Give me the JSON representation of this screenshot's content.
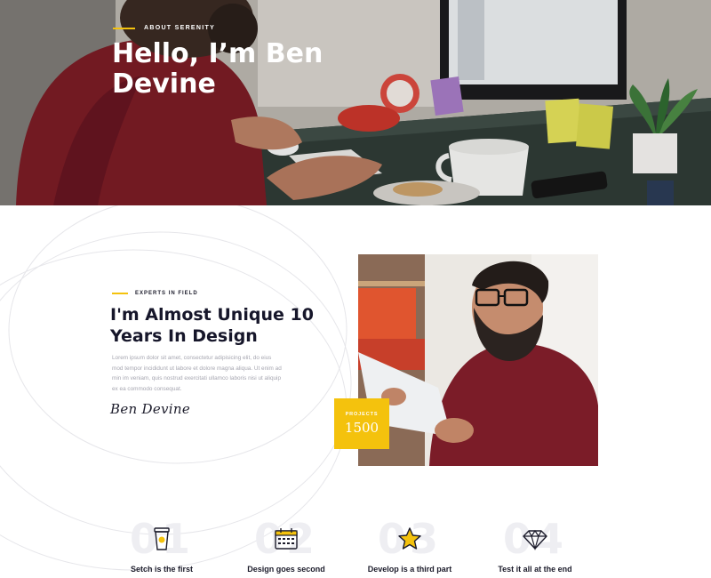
{
  "hero": {
    "tag": "ABOUT SERENITY",
    "title": "Hello, I’m Ben Devine"
  },
  "about": {
    "tag": "EXPERTS IN FIELD",
    "title": "I'm Almost Unique 10 Years In Design",
    "text": "Lorem ipsum dolor sit amet, consectetur adipisicing elit, do eius mod tempor incididunt ut labore et dolore magna aliqua. Ut enim ad min im veniam, quis nostrud exercitati ullamco laboris nisi ut aliquip ex ea commodo consequat.",
    "signature": "Ben Devine"
  },
  "projects": {
    "label": "PROJECTS",
    "count": "1500"
  },
  "steps": [
    {
      "number": "01",
      "label": "Setch is the first",
      "icon": "coffee-cup-icon"
    },
    {
      "number": "02",
      "label": "Design goes second",
      "icon": "calendar-icon"
    },
    {
      "number": "03",
      "label": "Develop is a third part",
      "icon": "star-icon"
    },
    {
      "number": "04",
      "label": "Test it all at the end",
      "icon": "diamond-icon"
    }
  ],
  "colors": {
    "accent": "#f4c20d",
    "heading": "#16162a",
    "body_text": "#a6a6b0"
  }
}
